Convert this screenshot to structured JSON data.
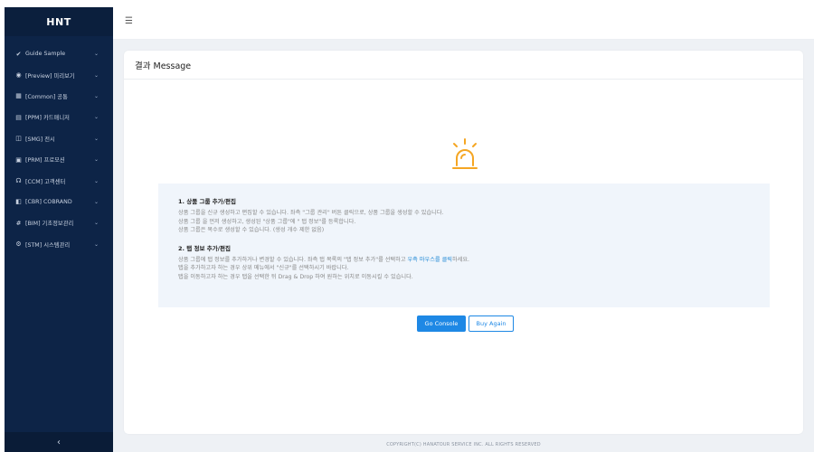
{
  "sidebar": {
    "brand": "HNT",
    "items": [
      {
        "icon": "✔",
        "label": "Guide Sample"
      },
      {
        "icon": "◉",
        "label": "[Preview] 미리보기"
      },
      {
        "icon": "▦",
        "label": "[Common] 공통"
      },
      {
        "icon": "▤",
        "label": "[PPM] 카드매니저"
      },
      {
        "icon": "◫",
        "label": "[SMG] 전시"
      },
      {
        "icon": "▣",
        "label": "[PRM] 프로모션"
      },
      {
        "icon": "☊",
        "label": "[CCM] 고객센터"
      },
      {
        "icon": "◧",
        "label": "[CBR] COBRAND"
      },
      {
        "icon": "#",
        "label": "[BIM] 기초정보관리"
      },
      {
        "icon": "⚙",
        "label": "[STM] 시스템관리"
      }
    ],
    "chevron": "⌄",
    "collapse": "‹"
  },
  "topbar": {
    "menu_icon": "☰"
  },
  "card": {
    "title": "결과 Message",
    "sections": [
      {
        "title": "1. 상품 그룹 추가/편집",
        "lines": [
          "상품 그룹을 신규 생성하고 편집할 수 있습니다. 좌측 \"그룹 관리\" 버튼 클릭으로, 상품 그룹을 생성할 수 있습니다.",
          "상품 그룹 을 먼저 생성하고, 생성된 \"상품 그룹\"에 \" 탭 정보\"를 등록합니다.",
          "상품 그룹은 복수로 생성할 수 있습니다. (생성 개수 제한 없음)"
        ]
      },
      {
        "title": "2. 탭 정보 추가/편집",
        "line1_prefix": "상품 그룹에 탭 정보를 추가하거나 변경할 수 있습니다. 좌측 탭 목록의 \"탭 정보 추가\"를 선택하고 ",
        "line1_highlight": "우측 마우스를 클릭",
        "line1_suffix": "하세요.",
        "lines": [
          "탭을 추가하고자 하는 경우 상위 메뉴에서 \"신규\"를 선택하시기 바랍니다.",
          "탭을 이동하고자 하는 경우 탭을 선택한 뒤 Drag & Drop 하여 원하는 위치로 이동시킬 수 있습니다."
        ]
      }
    ],
    "buttons": {
      "primary": "Go Console",
      "secondary": "Buy Again"
    }
  },
  "footer": "COPYRIGHT(C) HANATOUR SERVICE INC. ALL RIGHTS RESERVED",
  "colors": {
    "sidebar_bg": "#0d2447",
    "accent": "#1e88e5",
    "alarm": "#f5a623",
    "info_bg": "#f0f5fb"
  }
}
